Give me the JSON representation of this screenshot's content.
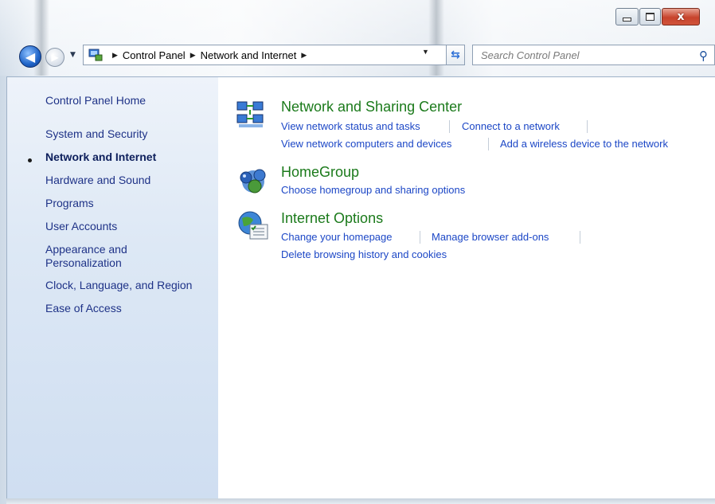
{
  "window": {
    "caption_buttons": {
      "minimize": "minimize",
      "maximize": "maximize",
      "close": "close"
    }
  },
  "nav": {
    "address_crumbs": [
      "Control Panel",
      "Network and Internet"
    ],
    "search_placeholder": "Search Control Panel"
  },
  "sidebar": {
    "home": "Control Panel Home",
    "items": [
      {
        "label": "System and Security",
        "current": false
      },
      {
        "label": "Network and Internet",
        "current": true
      },
      {
        "label": "Hardware and Sound",
        "current": false
      },
      {
        "label": "Programs",
        "current": false
      },
      {
        "label": "User Accounts",
        "current": false
      },
      {
        "label": "Appearance and",
        "label2": "Personalization",
        "current": false
      },
      {
        "label": "Clock, Language, and Region",
        "current": false
      },
      {
        "label": "Ease of Access",
        "current": false
      }
    ]
  },
  "categories": [
    {
      "title": "Network and Sharing Center",
      "icon": "network-sharing-icon",
      "tasks": [
        "View network status and tasks",
        "Connect to a network",
        "View network computers and devices",
        "Add a wireless device to the network"
      ]
    },
    {
      "title": "HomeGroup",
      "icon": "homegroup-icon",
      "tasks": [
        "Choose homegroup and sharing options"
      ]
    },
    {
      "title": "Internet Options",
      "icon": "internet-options-icon",
      "tasks": [
        "Change your homepage",
        "Manage browser add-ons",
        "Delete browsing history and cookies"
      ]
    }
  ],
  "colors": {
    "category_title": "#1b7a1b",
    "task_link": "#1c47c6",
    "sidebar_link": "#1e3287",
    "close_button": "#c7432c"
  }
}
